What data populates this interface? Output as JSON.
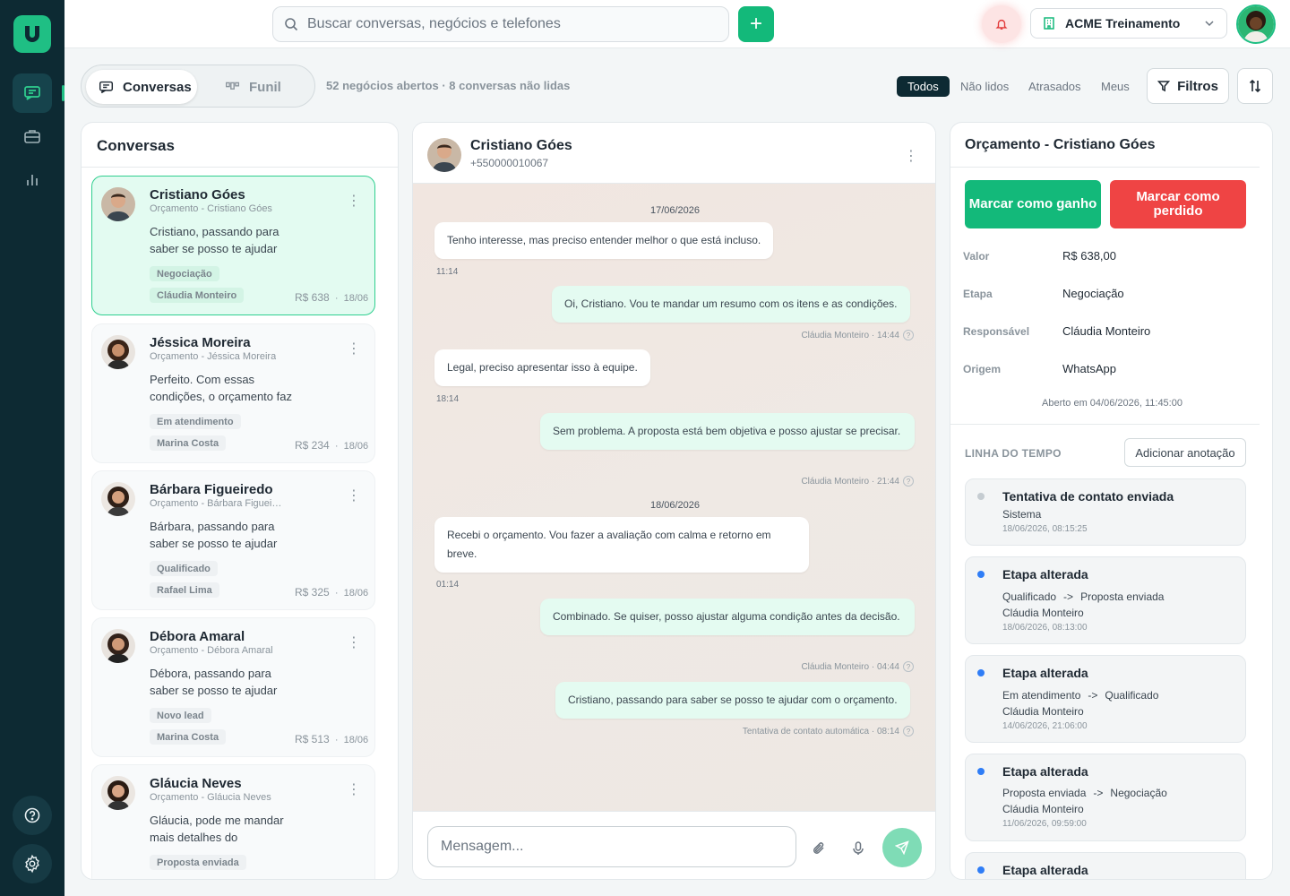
{
  "sidebar": {
    "logo_letter": "U",
    "items": [
      {
        "name": "chat",
        "icon": "chat-icon",
        "active": true
      },
      {
        "name": "deals",
        "icon": "briefcase-icon",
        "active": false
      },
      {
        "name": "reports",
        "icon": "bar-chart-icon",
        "active": false
      }
    ],
    "bottom": [
      {
        "icon": "help-icon"
      },
      {
        "icon": "gear-icon"
      }
    ]
  },
  "topbar": {
    "search_placeholder": "Buscar conversas, negócios e telefones",
    "add_icon": "+",
    "workspace": "ACME Treinamento"
  },
  "toolbar": {
    "tabs": [
      {
        "label": "Conversas",
        "active": true
      },
      {
        "label": "Funil",
        "active": false
      }
    ],
    "summary": "52 negócios abertos · 8 conversas não lidas",
    "filters": [
      {
        "label": "Todos",
        "active": true
      },
      {
        "label": "Não lidos",
        "active": false
      },
      {
        "label": "Atrasados",
        "active": false
      },
      {
        "label": "Meus",
        "active": false
      }
    ],
    "filters_button": "Filtros"
  },
  "conversations": {
    "title": "Conversas",
    "items": [
      {
        "name": "Cristiano Góes",
        "subtitle": "Orçamento - Cristiano Góes",
        "message": "Cristiano, passando para saber se posso te ajudar com o orçamento.",
        "stage": "Negociação",
        "owner": "Cláudia Monteiro",
        "value": "R$ 638",
        "date": "18/06",
        "selected": true
      },
      {
        "name": "Jéssica Moreira",
        "subtitle": "Orçamento - Jéssica Moreira",
        "message": "Perfeito. Com essas condições, o orçamento faz sentido.",
        "stage": "Em atendimento",
        "owner": "Marina Costa",
        "value": "R$ 234",
        "date": "18/06",
        "selected": false
      },
      {
        "name": "Bárbara Figueiredo",
        "subtitle": "Orçamento - Bárbara Figueiredo",
        "message": "Bárbara, passando para saber se posso te ajudar com o orçamento.",
        "stage": "Qualificado",
        "owner": "Rafael Lima",
        "value": "R$ 325",
        "date": "18/06",
        "selected": false
      },
      {
        "name": "Débora Amaral",
        "subtitle": "Orçamento - Débora Amaral",
        "message": "Débora, passando para saber se posso te ajudar com o orçamento.",
        "stage": "Novo lead",
        "owner": "Marina Costa",
        "value": "R$ 513",
        "date": "18/06",
        "selected": false
      },
      {
        "name": "Gláucia Neves",
        "subtitle": "Orçamento - Gláucia Neves",
        "message": "Gláucia, pode me mandar mais detalhes do orçamento?",
        "stage": "Proposta enviada",
        "owner": "",
        "value": "",
        "date": "",
        "selected": false
      }
    ]
  },
  "chat": {
    "contact_name": "Cristiano Góes",
    "contact_phone": "+550000010067",
    "dates": [
      "17/06/2026",
      "18/06/2026"
    ],
    "messages": [
      {
        "dir": "in",
        "text": "Tenho interesse, mas preciso entender melhor o que está incluso.",
        "time": "11:14"
      },
      {
        "dir": "out",
        "text": "Oi, Cristiano. Vou te mandar um resumo com os itens e as condições.",
        "author": "Cláudia Monteiro",
        "time": "14:44"
      },
      {
        "dir": "in",
        "text": "Legal, preciso apresentar isso à equipe.",
        "time": "18:14"
      },
      {
        "dir": "out",
        "text": "Sem problema. A proposta está bem objetiva e posso ajustar se precisar.",
        "author": "Cláudia Monteiro",
        "time": "21:44"
      },
      {
        "dir": "in",
        "text": "Recebi o orçamento. Vou fazer a avaliação com calma e retorno em breve.",
        "time": "01:14"
      },
      {
        "dir": "out",
        "text": "Combinado. Se quiser, posso ajustar alguma condição antes da decisão.",
        "author": "Cláudia Monteiro",
        "time": "04:44"
      },
      {
        "dir": "out",
        "text": "Cristiano, passando para saber se posso te ajudar com o orçamento.",
        "author": "Tentativa de contato automática",
        "time": "08:14"
      }
    ],
    "input_placeholder": "Mensagem...",
    "sep": "·",
    "help_mark": "?"
  },
  "deal": {
    "title": "Orçamento - Cristiano Góes",
    "won_label": "Marcar como ganho",
    "lost_label": "Marcar como perdido",
    "fields": [
      {
        "label": "Valor",
        "value": "R$ 638,00"
      },
      {
        "label": "Etapa",
        "value": "Negociação"
      },
      {
        "label": "Responsável",
        "value": "Cláudia Monteiro"
      },
      {
        "label": "Origem",
        "value": "WhatsApp"
      }
    ],
    "opened_at": "Aberto em 04/06/2026, 11:45:00",
    "timeline_label": "LINHA DO TEMPO",
    "add_note_label": "Adicionar anotação",
    "timeline": [
      {
        "title": "Tentativa de contato enviada",
        "actor": "Sistema",
        "time": "18/06/2026, 08:15:25",
        "dot": "#c5ccd1"
      },
      {
        "title": "Etapa alterada",
        "from": "Qualificado",
        "to": "Proposta enviada",
        "actor": "Cláudia Monteiro",
        "time": "18/06/2026, 08:13:00",
        "dot": "#2f7df6"
      },
      {
        "title": "Etapa alterada",
        "from": "Em atendimento",
        "to": "Qualificado",
        "actor": "Cláudia Monteiro",
        "time": "14/06/2026, 21:06:00",
        "dot": "#2f7df6"
      },
      {
        "title": "Etapa alterada",
        "from": "Proposta enviada",
        "to": "Negociação",
        "actor": "Cláudia Monteiro",
        "time": "11/06/2026, 09:59:00",
        "dot": "#2f7df6"
      },
      {
        "title": "Etapa alterada",
        "dot": "#2f7df6"
      }
    ],
    "arrow": "->"
  },
  "colors": {
    "brand": "#1fbf84",
    "accent_green": "#13b97a",
    "danger": "#ef4444",
    "sidebar": "#0d2a33",
    "info": "#2f7df6"
  }
}
